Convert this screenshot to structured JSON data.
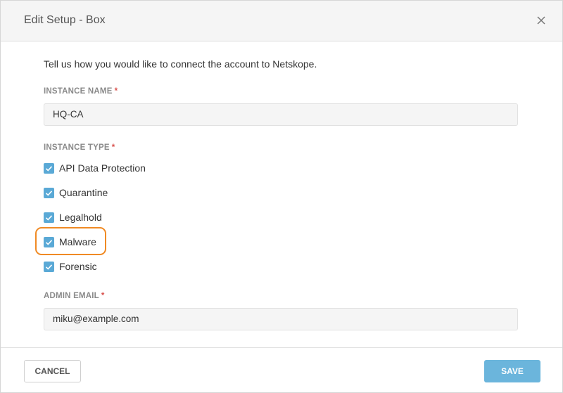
{
  "dialog": {
    "title": "Edit Setup - Box",
    "intro": "Tell us how you would like to connect the account to Netskope."
  },
  "instance_name": {
    "label": "INSTANCE NAME",
    "required_mark": "*",
    "value": "HQ-CA"
  },
  "instance_type": {
    "label": "INSTANCE TYPE",
    "required_mark": "*",
    "options": [
      {
        "label": "API Data Protection",
        "checked": true
      },
      {
        "label": "Quarantine",
        "checked": true
      },
      {
        "label": "Legalhold",
        "checked": true
      },
      {
        "label": "Malware",
        "checked": true
      },
      {
        "label": "Forensic",
        "checked": true
      }
    ]
  },
  "admin_email": {
    "label": "ADMIN EMAIL",
    "required_mark": "*",
    "value": "miku@example.com"
  },
  "footer": {
    "cancel_label": "CANCEL",
    "save_label": "SAVE"
  },
  "colors": {
    "checkbox": "#5aa9d6",
    "save_button": "#6bb5dc",
    "highlight": "#f08a24",
    "required": "#d9534f"
  }
}
